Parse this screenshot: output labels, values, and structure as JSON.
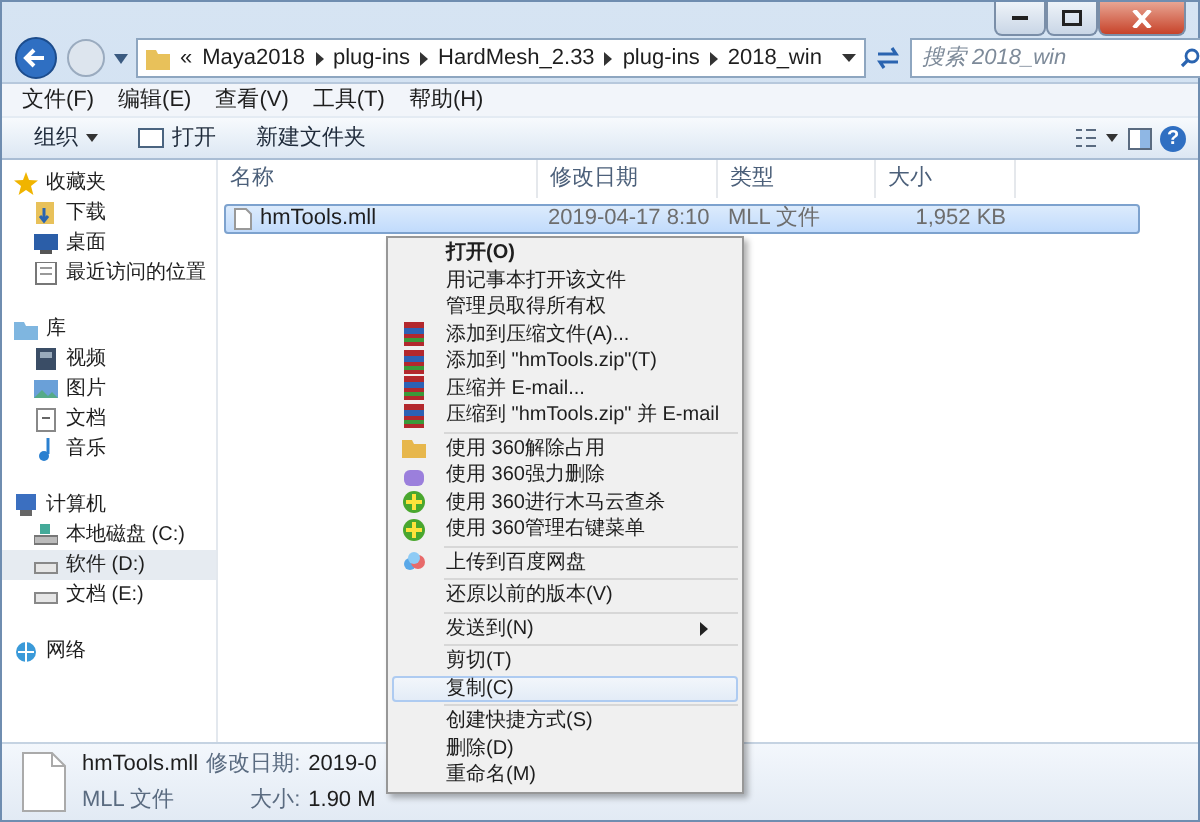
{
  "address_bar": {
    "overflow": "«",
    "crumbs": [
      "Maya2018",
      "plug-ins",
      "HardMesh_2.33",
      "plug-ins",
      "2018_win"
    ]
  },
  "search": {
    "placeholder": "搜索 2018_win"
  },
  "menu_bar": [
    "文件(F)",
    "编辑(E)",
    "查看(V)",
    "工具(T)",
    "帮助(H)"
  ],
  "help_button": "?",
  "toolbar": [
    {
      "label": "组织",
      "kind": "dropdown"
    },
    {
      "label": "打开",
      "kind": "open"
    },
    {
      "label": "新建文件夹",
      "kind": "plain"
    }
  ],
  "sidebar": {
    "groups": [
      {
        "label": "收藏夹",
        "kind": "star",
        "children": [
          {
            "label": "下载",
            "kind": "download",
            "selected": false
          },
          {
            "label": "桌面",
            "kind": "desktop",
            "selected": false
          },
          {
            "label": "最近访问的位置",
            "kind": "recent",
            "selected": false
          }
        ]
      },
      {
        "label": "库",
        "kind": "library",
        "children": [
          {
            "label": "视频",
            "kind": "video",
            "selected": false
          },
          {
            "label": "图片",
            "kind": "picture",
            "selected": false
          },
          {
            "label": "文档",
            "kind": "document",
            "selected": false
          },
          {
            "label": "音乐",
            "kind": "music",
            "selected": false
          }
        ]
      },
      {
        "label": "计算机",
        "kind": "computer",
        "children": [
          {
            "label": "本地磁盘 (C:)",
            "kind": "system-drive",
            "selected": false
          },
          {
            "label": "软件 (D:)",
            "kind": "drive",
            "selected": true
          },
          {
            "label": "文档 (E:)",
            "kind": "drive",
            "selected": false
          }
        ]
      },
      {
        "label": "网络",
        "kind": "network"
      }
    ]
  },
  "table": {
    "columns": [
      "名称",
      "修改日期",
      "类型",
      "大小"
    ],
    "rows": [
      {
        "cells": [
          "hmTools.mll",
          "2019-04-17 8:10",
          "MLL 文件",
          "1,952 KB"
        ],
        "selected": true
      }
    ]
  },
  "context_menu": {
    "groups": [
      [
        {
          "label": "打开(O)",
          "kind": "plain",
          "default": true,
          "selected": false
        },
        {
          "label": "用记事本打开该文件",
          "kind": "plain",
          "default": false,
          "selected": false
        },
        {
          "label": "管理员取得所有权",
          "kind": "plain",
          "default": false,
          "selected": false
        },
        {
          "label": "添加到压缩文件(A)...",
          "kind": "archive",
          "default": false,
          "selected": false
        },
        {
          "label": "添加到 \"hmTools.zip\"(T)",
          "kind": "archive",
          "default": false,
          "selected": false
        },
        {
          "label": "压缩并 E-mail...",
          "kind": "archive",
          "default": false,
          "selected": false
        },
        {
          "label": "压缩到 \"hmTools.zip\" 并 E-mail",
          "kind": "archive",
          "default": false,
          "selected": false
        }
      ],
      [
        {
          "label": "使用 360解除占用",
          "kind": "unlock",
          "default": false,
          "selected": false
        },
        {
          "label": "使用 360强力删除",
          "kind": "shred",
          "default": false,
          "selected": false
        },
        {
          "label": "使用 360进行木马云查杀",
          "kind": "scan",
          "default": false,
          "selected": false
        },
        {
          "label": "使用 360管理右键菜单",
          "kind": "scan",
          "default": false,
          "selected": false
        }
      ],
      [
        {
          "label": "上传到百度网盘",
          "kind": "cloud",
          "default": false,
          "selected": false
        }
      ],
      [
        {
          "label": "还原以前的版本(V)",
          "kind": "plain",
          "default": false,
          "selected": false
        }
      ],
      [
        {
          "label": "发送到(N)",
          "kind": "submenu",
          "default": false,
          "selected": false
        }
      ],
      [
        {
          "label": "剪切(T)",
          "kind": "plain",
          "default": false,
          "selected": false
        },
        {
          "label": "复制(C)",
          "kind": "plain",
          "default": false,
          "selected": true
        }
      ],
      [
        {
          "label": "创建快捷方式(S)",
          "kind": "plain",
          "default": false,
          "selected": false
        },
        {
          "label": "删除(D)",
          "kind": "plain",
          "default": false,
          "selected": false
        },
        {
          "label": "重命名(M)",
          "kind": "plain",
          "default": false,
          "selected": false
        }
      ]
    ]
  },
  "details_pane": {
    "name": "hmTools.mll",
    "type": "MLL 文件",
    "fields": [
      {
        "label": "修改日期:",
        "value": "2019-0"
      },
      {
        "label": "大小:",
        "value": "1.90 M"
      }
    ]
  }
}
